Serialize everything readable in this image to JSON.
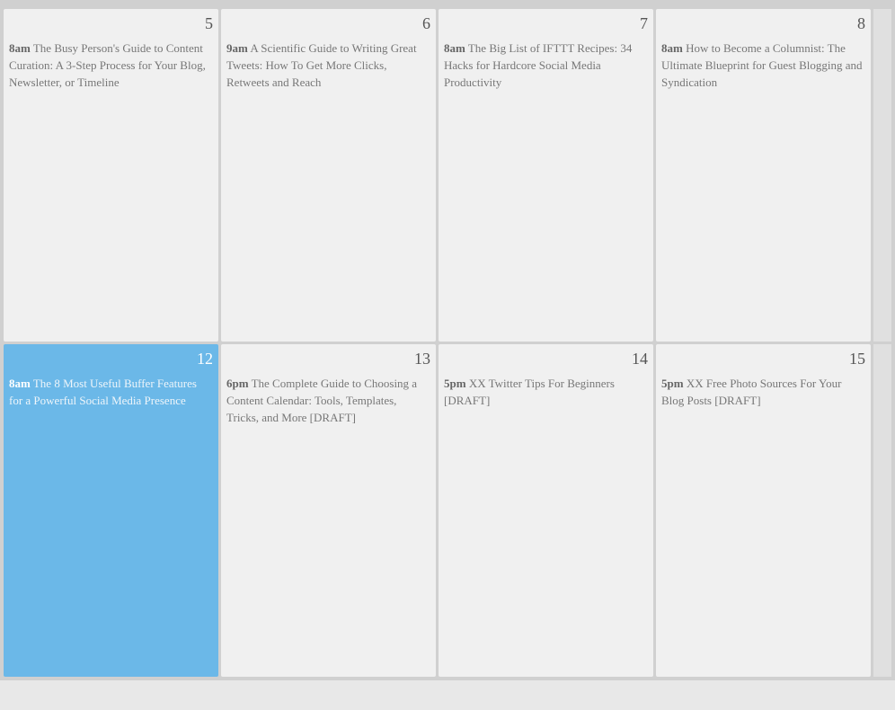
{
  "calendar": {
    "rows": [
      {
        "cells": [
          {
            "date": "5",
            "highlighted": false,
            "event_time": "8am",
            "event_text": "The Busy Person's Guide to Content Curation: A 3-Step Process for Your Blog, Newsletter, or Timeline"
          },
          {
            "date": "6",
            "highlighted": false,
            "event_time": "9am",
            "event_text": "A Scientific Guide to Writing Great Tweets: How To Get More Clicks, Retweets and Reach"
          },
          {
            "date": "7",
            "highlighted": false,
            "event_time": "8am",
            "event_text": "The Big List of IFTTT Recipes: 34 Hacks for Hardcore Social Media Productivity"
          },
          {
            "date": "8",
            "highlighted": false,
            "event_time": "8am",
            "event_text": "How to Become a Columnist: The Ultimate Blueprint for Guest Blogging and Syndication"
          }
        ]
      },
      {
        "cells": [
          {
            "date": "12",
            "highlighted": true,
            "event_time": "8am",
            "event_text": "The 8 Most Useful Buffer Features for a Powerful Social Media Presence"
          },
          {
            "date": "13",
            "highlighted": false,
            "event_time": "6pm",
            "event_text": "The Complete Guide to Choosing a Content Calendar: Tools, Templates, Tricks, and More [DRAFT]"
          },
          {
            "date": "14",
            "highlighted": false,
            "event_time": "5pm",
            "event_text": "XX Twitter Tips For Beginners [DRAFT]"
          },
          {
            "date": "15",
            "highlighted": false,
            "event_time": "5pm",
            "event_text": "XX Free Photo Sources For Your Blog Posts [DRAFT]"
          }
        ]
      }
    ]
  }
}
